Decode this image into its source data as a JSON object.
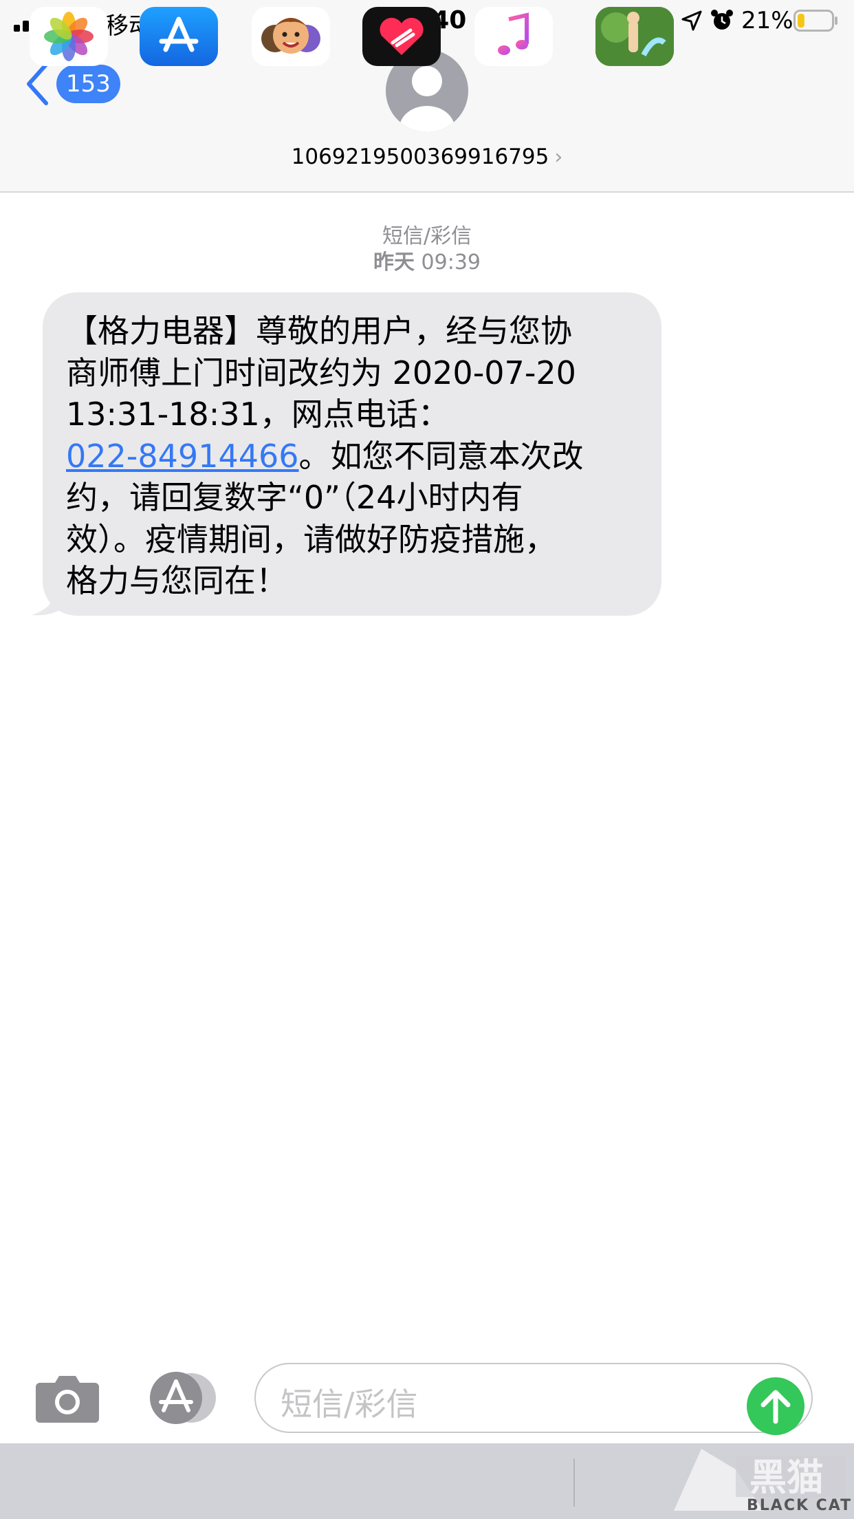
{
  "status_bar": {
    "carrier": "中国移动",
    "time": "21:40",
    "battery_percent": "21%",
    "battery_level": 0.21,
    "icons": [
      "signal-icon",
      "wifi-icon",
      "rotation-lock-icon",
      "location-icon",
      "alarm-icon",
      "battery-icon"
    ]
  },
  "header": {
    "back_badge": "153",
    "contact_number": "1069219500369916795",
    "chevron": "›",
    "avatar_icon": "person-icon"
  },
  "conversation": {
    "type_label": "短信/彩信",
    "time_day": "昨天",
    "time_clock": "09:39"
  },
  "message": {
    "line1": "【格力电器】尊敬的用户，经与您协",
    "line2": "商师傅上门时间改约为 2020-07-20",
    "line3": "13:31-18:31，网点电话：",
    "phone_link": "022-84914466",
    "line4_rest": "。如您不同意本次改",
    "line5": "约，请回复数字“0”（24小时内有",
    "line6": "效）。疫情期间，请做好防疫措施，",
    "line7": "格力与您同在！"
  },
  "input_bar": {
    "placeholder": "短信/彩信",
    "icons": [
      "camera-icon",
      "appstore-icon",
      "send-arrow-icon"
    ]
  },
  "app_drawer": {
    "apps": [
      "photos-icon",
      "appstore-icon",
      "memoji-icon",
      "digital-touch-icon",
      "music-icon",
      "game-icon"
    ],
    "watermark_text": "BLACK CAT"
  },
  "colors": {
    "accent_blue": "#3478f6",
    "badge_blue": "#3e83f7",
    "bubble_gray": "#e9e9eb",
    "send_green": "#34c759",
    "secondary_text": "#8e8e93"
  }
}
